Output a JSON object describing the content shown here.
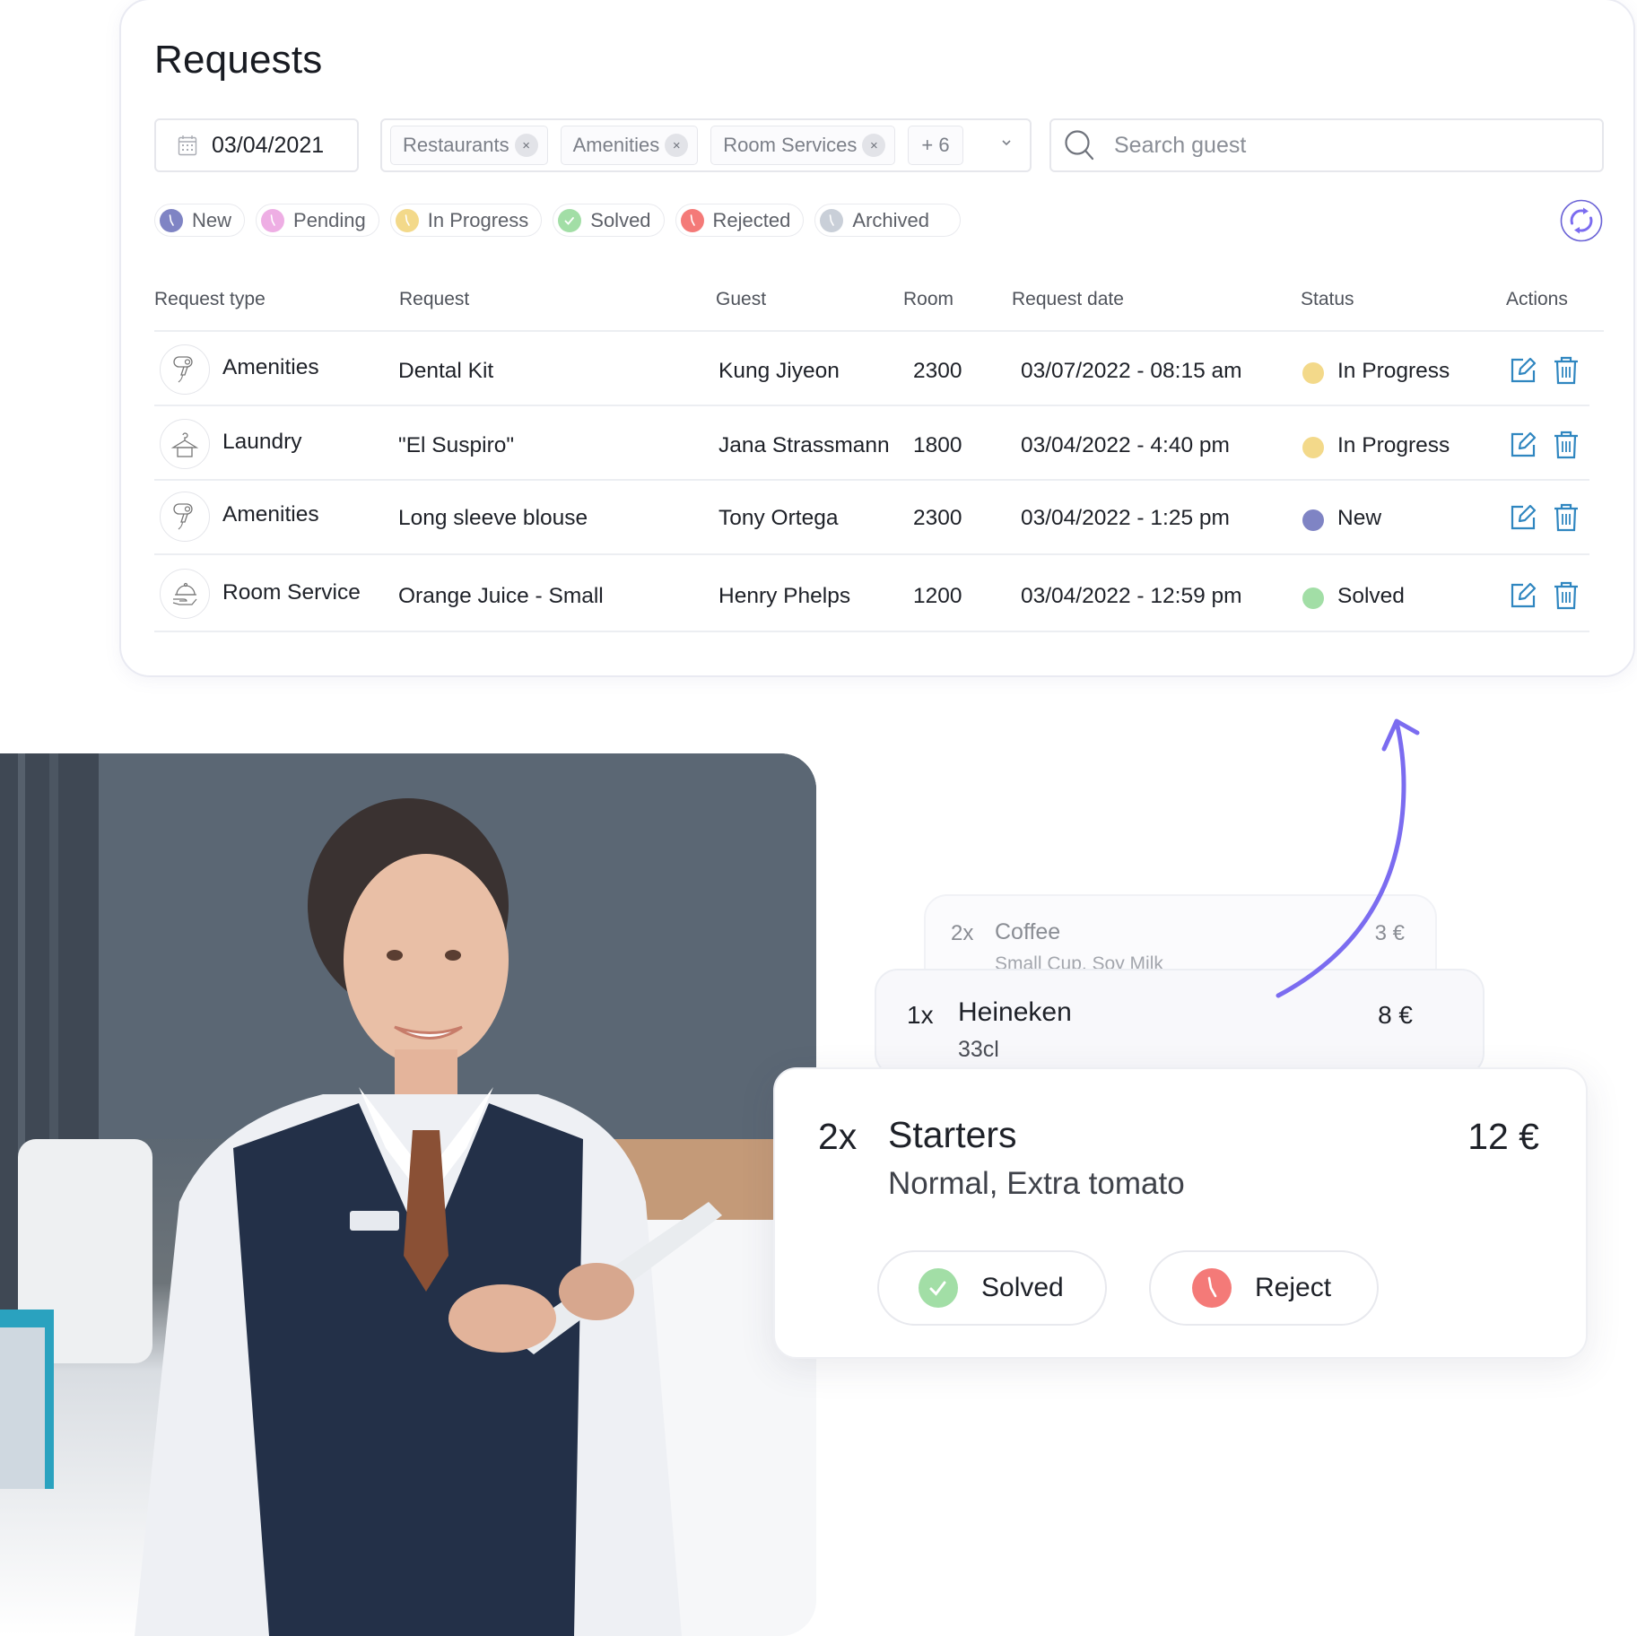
{
  "requests": {
    "title": "Requests",
    "date_filter": {
      "value": "03/04/2021",
      "icon": "calendar-icon"
    },
    "category_filter": {
      "chips": [
        "Restaurants",
        "Amenities",
        "Room Services"
      ],
      "remove_glyph": "×",
      "more_label": "+ 6",
      "icon": "chevron-down-icon"
    },
    "search": {
      "placeholder": "Search guest",
      "value": "",
      "icon": "search-icon"
    },
    "status_pills": [
      {
        "label": "New",
        "color": "#7f84c4",
        "icon": "clock-icon"
      },
      {
        "label": "Pending",
        "color": "#eeaee4",
        "icon": "clock-icon"
      },
      {
        "label": "In Progress",
        "color": "#f3d98a",
        "icon": "clock-icon"
      },
      {
        "label": "Solved",
        "color": "#a2dea6",
        "icon": "check-icon"
      },
      {
        "label": "Rejected",
        "color": "#f47a78",
        "icon": "clock-icon"
      },
      {
        "label": "Archived",
        "color": "#c9cfd8",
        "icon": "clock-icon"
      }
    ],
    "refresh_icon": "refresh-icon",
    "table": {
      "headers": [
        "Request type",
        "Request",
        "Guest",
        "Room",
        "Request date",
        "Status",
        "Actions"
      ],
      "rows": [
        {
          "type": "Amenities",
          "type_icon": "hair-dryer-icon",
          "request": "Dental Kit",
          "guest": "Kung Jiyeon",
          "room": "2300",
          "date": "03/07/2022 - 08:15 am",
          "status": "In Progress",
          "status_color": "#f3d98a"
        },
        {
          "type": "Laundry",
          "type_icon": "hanger-icon",
          "request": "\"El Suspiro\"",
          "guest": "Jana Strassmann",
          "room": "1800",
          "date": "03/04/2022 -  4:40 pm",
          "status": "In Progress",
          "status_color": "#f3d98a"
        },
        {
          "type": "Amenities",
          "type_icon": "hair-dryer-icon",
          "request": "Long sleeve blouse",
          "guest": "Tony Ortega",
          "room": "2300",
          "date": "03/04/2022 -  1:25 pm",
          "status": "New",
          "status_color": "#7f84c4"
        },
        {
          "type": "Room Service",
          "type_icon": "cloche-icon",
          "request": "Orange Juice - Small",
          "guest": "Henry Phelps",
          "room": "1200",
          "date": "03/04/2022 - 12:59 pm",
          "status": "Solved",
          "status_color": "#a2dea6"
        }
      ],
      "actions": {
        "edit_icon": "edit-icon",
        "delete_icon": "trash-icon",
        "color": "#2f86c0"
      }
    }
  },
  "orders": [
    {
      "qty": "2x",
      "name": "Coffee",
      "details": "Small Cup, Soy Milk",
      "price": "3 €"
    },
    {
      "qty": "1x",
      "name": "Heineken",
      "details": "33cl",
      "price": "8 €"
    },
    {
      "qty": "2x",
      "name": "Starters",
      "details": "Normal, Extra tomato",
      "price": "12 €",
      "buttons": {
        "solved": "Solved",
        "reject": "Reject"
      }
    }
  ],
  "colors": {
    "accent": "#7b6cf0",
    "text": "#1e2128",
    "border": "#e6e7ec"
  },
  "photo": {
    "description": "Smiling hotel staff member in navy vest holding a tablet"
  }
}
